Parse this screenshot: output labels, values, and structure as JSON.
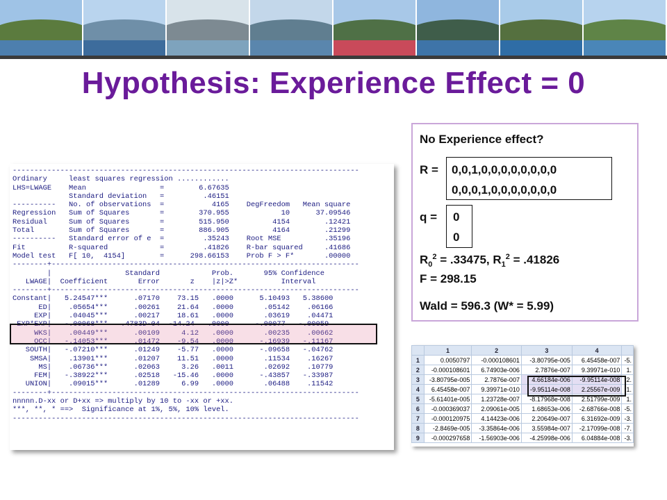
{
  "banner": {
    "photos": [
      {
        "name": "hilltop-village-photo",
        "sky": "#9fc3e6",
        "hill": "#5b7b3e",
        "lake": "#4d7fae"
      },
      {
        "name": "mountain-lake-photo",
        "sky": "#b9d4ee",
        "hill": "#6f8fa8",
        "lake": "#3d6c9c"
      },
      {
        "name": "lakeside-promenade-photo",
        "sky": "#d8e3ea",
        "hill": "#7d8a92",
        "lake": "#7ea3bd"
      },
      {
        "name": "lakeside-town-photo",
        "sky": "#c3d7ea",
        "hill": "#607e90",
        "lake": "#5a86ad"
      },
      {
        "name": "flower-garden-photo",
        "sky": "#a8c8e8",
        "hill": "#4f7046",
        "lake": "#c94a5a"
      },
      {
        "name": "mountain-bay-photo",
        "sky": "#8fb6de",
        "hill": "#3f5d4a",
        "lake": "#3e74a8"
      },
      {
        "name": "lake-view-photo",
        "sky": "#a9cbe9",
        "hill": "#55703f",
        "lake": "#2f6da6"
      },
      {
        "name": "bench-by-lake-photo",
        "sky": "#b7d3ee",
        "hill": "#5f8447",
        "lake": "#4a86b8"
      }
    ]
  },
  "title": "Hypothesis: Experience Effect = 0",
  "regression_output": "--------------------------------------------------------------------------------\nOrdinary     least squares regression ............\nLHS=LWAGE    Mean                 =        6.67635\n             Standard deviation   =         .46151\n----------   No. of observations  =           4165    DegFreedom   Mean square\nRegression   Sum of Squares       =        370.955            10      37.09546\nResidual     Sum of Squares       =        515.950          4154        .12421\nTotal        Sum of Squares       =        886.905          4164        .21299\n----------   Standard error of e  =         .35243    Root MSE          .35196\nFit          R-squared            =         .41826    R-bar squared     .41686\nModel test   F[ 10,  4154]        =      298.66153    Prob F > F*       .00000\n--------+-----------------------------------------------------------------------\n        |                 Standard            Prob.       95% Confidence\n   LWAGE|  Coefficient       Error       z    |z|>Z*          Interval\n--------+-----------------------------------------------------------------------\nConstant|   5.24547***      .07170    73.15   .0000      5.10493   5.38600\n      ED|    .05654***      .00261    21.64   .0000       .05142    .06166\n     EXP|    .04045***      .00217    18.61   .0000       .03619    .04471\n EXP*EXP|   -.00068***   .4783D-04  -14.24   .0000      -.00077   -.00059\n     WKS|    .00449***      .00109     4.12   .0000       .00235    .00662\n     OCC|   -.14053***      .01472    -9.54   .0000      -.16939   -.11167\n   SOUTH|   -.07210***      .01249    -5.77   .0000      -.09658   -.04762\n    SMSA|    .13901***      .01207    11.51   .0000       .11534    .16267\n      MS|    .06736***      .02063     3.26   .0011       .02692    .10779\n     FEM|   -.38922***      .02518   -15.46   .0000      -.43857   -.33987\n   UNION|    .09015***      .01289     6.99   .0000       .06488    .11542\n--------+-----------------------------------------------------------------------\nnnnnn.D-xx or D+xx => multiply by 10 to -xx or +xx.\n***, **, * ==>  Significance at 1%, 5%, 10% level.\n--------------------------------------------------------------------------------",
  "hypothesis": {
    "heading": "No Experience effect?",
    "r_label": "R =",
    "r_row1": "0,0,1,0,0,0,0,0,0,0,0",
    "r_row2": "0,0,0,1,0,0,0,0,0,0,0",
    "q_label": "q =",
    "q_row1": "0",
    "q_row2": "0",
    "r0_base": "R",
    "r0_sub": "0",
    "r0_sup": "2",
    "r0_rest": " = .33475,  R",
    "r1_sub": "1",
    "r1_sup": "2",
    "r1_rest": " = .41826",
    "f_line": "F    =  298.15",
    "wald_line": "Wald = 596.3 (W* = 5.99)"
  },
  "matrix": {
    "col_headers": [
      "",
      "1",
      "2",
      "3",
      "4",
      ""
    ],
    "rows": [
      [
        "1",
        "0.0050797",
        "-0.000108601",
        "-3.80795e-005",
        "6.45458e-007",
        "-5."
      ],
      [
        "2",
        "-0.000108601",
        "6.74903e-006",
        "2.7876e-007",
        "9.39971e-010",
        "1."
      ],
      [
        "3",
        "-3.80795e-005",
        "2.7876e-007",
        "4.66184e-006",
        "-9.95114e-008",
        "2."
      ],
      [
        "4",
        "6.45458e-007",
        "9.39971e-010",
        "-9.95114e-008",
        "2.25567e-009",
        "1."
      ],
      [
        "5",
        "-5.61401e-005",
        "1.23728e-007",
        "-8.17968e-008",
        "2.51799e-009",
        "1."
      ],
      [
        "6",
        "-0.000369037",
        "2.09061e-005",
        "1.68653e-006",
        "-2.68766e-008",
        "-5."
      ],
      [
        "7",
        "-0.000120975",
        "4.14423e-006",
        "2.20649e-007",
        "6.31692e-009",
        "-3."
      ],
      [
        "8",
        "-2.8469e-005",
        "-3.35864e-006",
        "3.55984e-007",
        "-2.17099e-008",
        "-7."
      ],
      [
        "9",
        "-0.000297658",
        "-1.56903e-006",
        "-4.25998e-006",
        "6.04884e-008",
        "-3."
      ]
    ]
  }
}
